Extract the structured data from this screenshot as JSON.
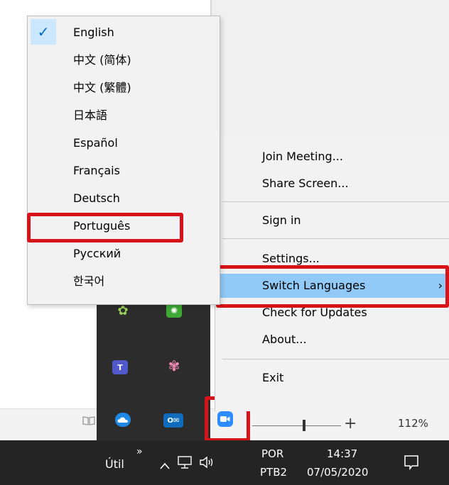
{
  "context_menu": {
    "items": [
      "Join Meeting...",
      "Share Screen...",
      "Sign in",
      "Settings...",
      "Switch Languages",
      "Check for Updates",
      "About...",
      "Exit"
    ],
    "submenu_arrow": "›"
  },
  "language_menu": {
    "check_mark": "✓",
    "items": [
      "English",
      "中文 (简体)",
      "中文 (繁體)",
      "日本語",
      "Español",
      "Français",
      "Deutsch",
      "Português",
      "Русский",
      "한국어"
    ],
    "selected": "English",
    "highlight_color": "#91c9f7"
  },
  "status_bar": {
    "zoom_level": "112%",
    "zoom_plus": "+"
  },
  "tray_icons": [
    "mobile-icon",
    "green-app-icon",
    "teams-icon",
    "character-icon",
    "onedrive-icon",
    "outlook-icon",
    "zoom-icon"
  ],
  "taskbar": {
    "toolbar_label": "Útil",
    "toolbar_chevron": "»",
    "tray_up_arrow": "^",
    "volume_icon": "◁))",
    "lang_code": "POR",
    "lang_layout": "PTB2",
    "time": "14:37",
    "date": "07/05/2020"
  },
  "annotation_color": "#d7141a"
}
